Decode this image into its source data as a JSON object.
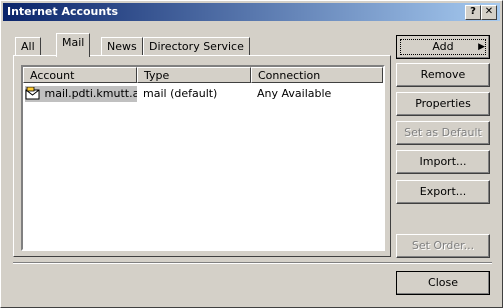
{
  "window": {
    "title": "Internet Accounts",
    "help_label": "?",
    "close_label": "✕"
  },
  "tabs": [
    "All",
    "Mail",
    "News",
    "Directory Service"
  ],
  "list": {
    "columns": [
      "Account",
      "Type",
      "Connection"
    ],
    "rows": [
      {
        "account": "mail.pdti.kmutt.ac...",
        "type": "mail (default)",
        "connection": "Any Available"
      }
    ]
  },
  "buttons": {
    "add": "Add",
    "add_arrow": "▶",
    "remove": "Remove",
    "properties": "Properties",
    "set_default": "Set as Default",
    "import": "Import...",
    "export": "Export...",
    "set_order": "Set Order...",
    "close": "Close"
  }
}
